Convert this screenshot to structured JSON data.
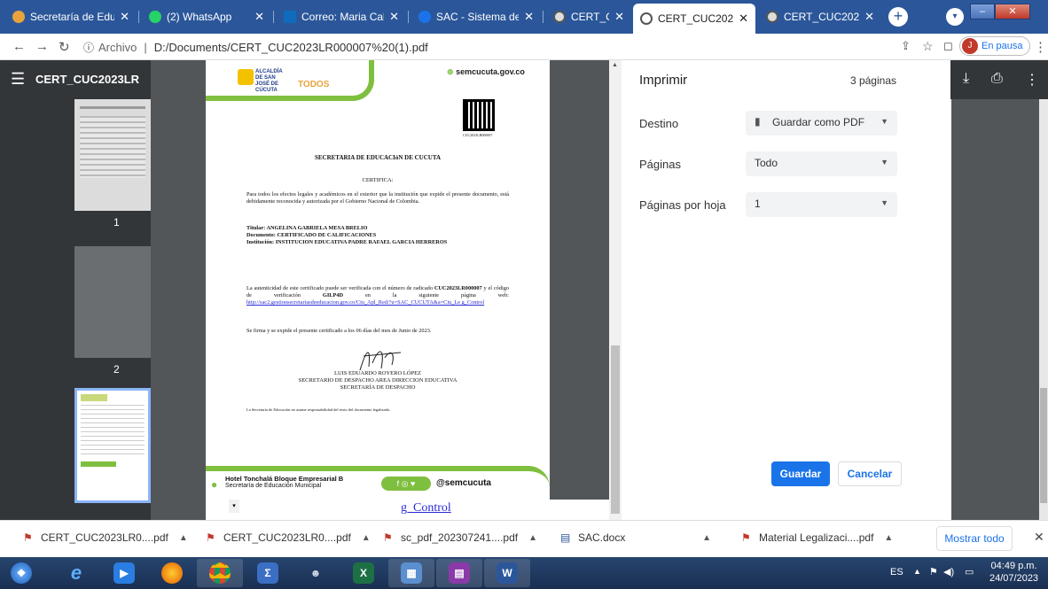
{
  "browser": {
    "tabs": [
      {
        "label": "Secretaría de Educ",
        "color": "#e8a33d"
      },
      {
        "label": "(2) WhatsApp",
        "color": "#25d366"
      },
      {
        "label": "Correo: Maria Cale",
        "color": "#0f6cbd"
      },
      {
        "label": "SAC - Sistema de",
        "color": "#1a73e8"
      },
      {
        "label": "CERT_CUC2023LR",
        "color": "#555555"
      },
      {
        "label": "CERT_CUC2023LR",
        "color": "#555555"
      },
      {
        "label": "CERT_CUC2023LR",
        "color": "#555555"
      }
    ],
    "active_tab": 5,
    "new_tab": "+",
    "url_prefix": "Archivo",
    "url": "D:/Documents/CERT_CUC2023LR000007%20(1).pdf",
    "profile_initial": "J",
    "profile_status": "En pausa"
  },
  "viewer": {
    "title": "CERT_CUC2023LR",
    "thumbnails": [
      "1",
      "2"
    ]
  },
  "document": {
    "site": "semcucuta.gov.co",
    "logo_text": "ALCALDÍA DE SAN JOSÉ DE CÚCUTA",
    "logo_sub": "TODOS",
    "qr_code_label": "CUC2023LR000007",
    "heading": "SECRETARIA DE EDUCACIóN DE CUCUTA",
    "certifica": "CERTIFICA:",
    "paragraph1": "Para todos los efectos legales y académicos en el exterior que la institución que expide el presente documento, está debidamente reconocida y autorizada por el Gobierno Nacional de Colombia.",
    "titular": "Titular: ANGELINA GABRIELA MESA BRELIO",
    "documento": "Documento: CERTIFICADO DE CALIFICACIONES",
    "institucion": "Institución: INSTITUCION EDUCATIVA PADRE RAFAEL GARCIA HERREROS",
    "verify_1": "La autenticidad de este certificado puede ser verificada con el número de radicado",
    "verify_radicado": "CUC2023LR000007",
    "verify_2": "y el código de verificación",
    "verify_code": "GILP4D",
    "verify_3": "en la siguiente página web:",
    "verify_link": "http://sac2.gestionsecretariasdeeducacion.gov.co/Ciu_Apl_Red/?u=SAC_CUCUTA&a=Ciu_Le g_Control",
    "expedicion": "Se firma y se expide el presente certificado a los 06 días del mes de Junio de 2023.",
    "signer": "LUIS EDUARDO ROYERO LÓPEZ",
    "signer_role1": "SECRETARIO DE DESPACHO AREA DIRECCION EDUCATIVA",
    "signer_role2": "SECRETARÍA DE DESPACHO",
    "disclaimer": "La Secretaría de Educación no asume responsabilidad del texto del documento legalizado.",
    "footer_place": "Hotel Tonchalá Bloque Empresarial B",
    "footer_sub": "Secretaría de Educación Municipal",
    "footer_social": "@semcucuta",
    "overflow_text": "g_Control"
  },
  "print": {
    "title": "Imprimir",
    "pages_count": "3 páginas",
    "destino_label": "Destino",
    "destino_value": "Guardar como PDF",
    "paginas_label": "Páginas",
    "paginas_value": "Todo",
    "por_hoja_label": "Páginas por hoja",
    "por_hoja_value": "1",
    "save": "Guardar",
    "cancel": "Cancelar",
    "accent": "#1a73e8"
  },
  "downloads": {
    "items": [
      {
        "name": "CERT_CUC2023LR0....pdf"
      },
      {
        "name": "CERT_CUC2023LR0....pdf"
      },
      {
        "name": "sc_pdf_202307241....pdf"
      },
      {
        "name": "SAC.docx"
      },
      {
        "name": "Material Legalizaci....pdf"
      }
    ],
    "show_all": "Mostrar todo"
  },
  "taskbar": {
    "lang": "ES",
    "time": "04:49 p.m.",
    "date": "24/07/2023"
  }
}
